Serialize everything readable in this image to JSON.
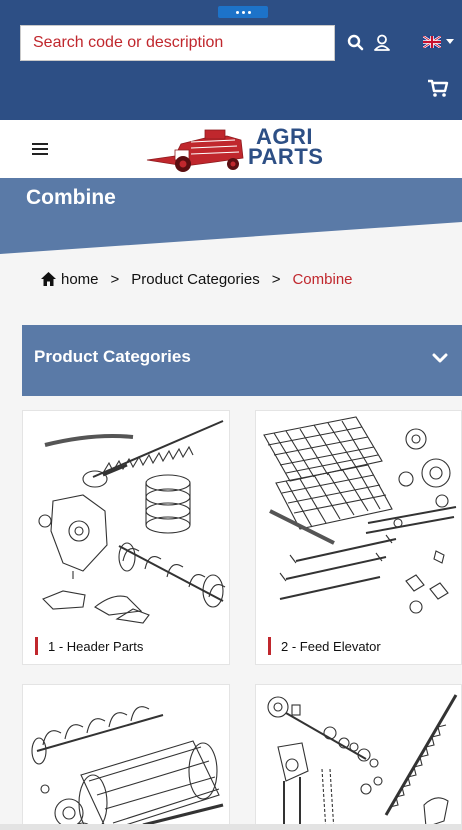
{
  "header": {
    "search": {
      "placeholder": "Search code or description",
      "value": ""
    },
    "icons": {
      "search": "search-icon",
      "user": "user-icon",
      "language": "uk-flag-icon",
      "cart": "cart-icon"
    }
  },
  "logo": {
    "line1": "AGRI",
    "line2": "PARTS"
  },
  "page": {
    "title": "Combine"
  },
  "breadcrumb": {
    "home": "home",
    "separator": ">",
    "level1": "Product Categories",
    "current": "Combine"
  },
  "section": {
    "title": "Product Categories"
  },
  "categories": [
    {
      "label": "1 - Header Parts"
    },
    {
      "label": "2 - Feed Elevator"
    },
    {
      "label": ""
    },
    {
      "label": ""
    }
  ],
  "colors": {
    "primary": "#2d4f85",
    "section": "#5a7aa7",
    "accent": "#c0272d"
  }
}
